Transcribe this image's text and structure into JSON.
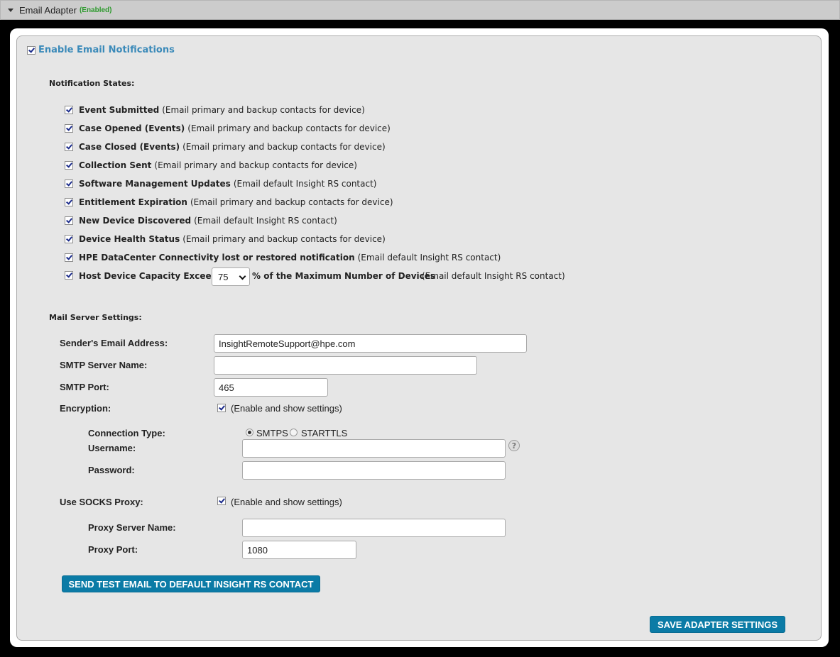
{
  "header": {
    "title": "Email Adapter",
    "status": "(Enabled)",
    "collapse_icon": "triangle-down-icon"
  },
  "enable": {
    "checked": true,
    "label": "Enable Email Notifications"
  },
  "notification_states": {
    "title": "Notification States:",
    "items": [
      {
        "label": "Event Submitted",
        "desc": "(Email primary and backup contacts for device)",
        "checked": true
      },
      {
        "label": "Case Opened (Events)",
        "desc": "(Email primary and backup contacts for device)",
        "checked": true
      },
      {
        "label": "Case Closed (Events)",
        "desc": "(Email primary and backup contacts for device)",
        "checked": true
      },
      {
        "label": "Collection Sent",
        "desc": "(Email primary and backup contacts for device)",
        "checked": true
      },
      {
        "label": "Software Management Updates",
        "desc": "(Email default Insight RS contact)",
        "checked": true
      },
      {
        "label": "Entitlement Expiration",
        "desc": "(Email primary and backup contacts for device)",
        "checked": true
      },
      {
        "label": "New Device Discovered",
        "desc": "(Email default Insight RS contact)",
        "checked": true
      },
      {
        "label": "Device Health Status",
        "desc": "(Email primary and backup contacts for device)",
        "checked": true
      },
      {
        "label": "HPE DataCenter Connectivity lost or restored notification",
        "desc": "(Email default Insight RS contact)",
        "checked": true
      }
    ],
    "capacity": {
      "checked": true,
      "label_before": "Host Device Capacity Exceeds",
      "selected_value": "75",
      "label_after": "% of the Maximum Number of Devices",
      "desc": "(Email default Insight RS contact)"
    }
  },
  "mail_server": {
    "title": "Mail Server Settings:",
    "sender_label": "Sender's Email Address:",
    "sender_value": "InsightRemoteSupport@hpe.com",
    "smtp_server_label": "SMTP Server Name:",
    "smtp_server_value": "",
    "smtp_port_label": "SMTP Port:",
    "smtp_port_value": "465",
    "encryption_label": "Encryption:",
    "encryption_checked": true,
    "encryption_text": "(Enable and show settings)",
    "connection_type_label": "Connection Type:",
    "connection_options": [
      {
        "label": "SMTPS",
        "selected": true
      },
      {
        "label": "STARTTLS",
        "selected": false
      }
    ],
    "username_label": "Username:",
    "username_value": "",
    "help_icon": "question-mark-icon",
    "help_glyph": "?",
    "password_label": "Password:",
    "password_value": "",
    "socks_label": "Use SOCKS Proxy:",
    "socks_checked": true,
    "socks_text": "(Enable and show settings)",
    "proxy_server_label": "Proxy Server Name:",
    "proxy_server_value": "",
    "proxy_port_label": "Proxy Port:",
    "proxy_port_value": "1080"
  },
  "buttons": {
    "send_test": "SEND TEST EMAIL TO DEFAULT INSIGHT RS CONTACT",
    "save": "SAVE ADAPTER SETTINGS"
  }
}
